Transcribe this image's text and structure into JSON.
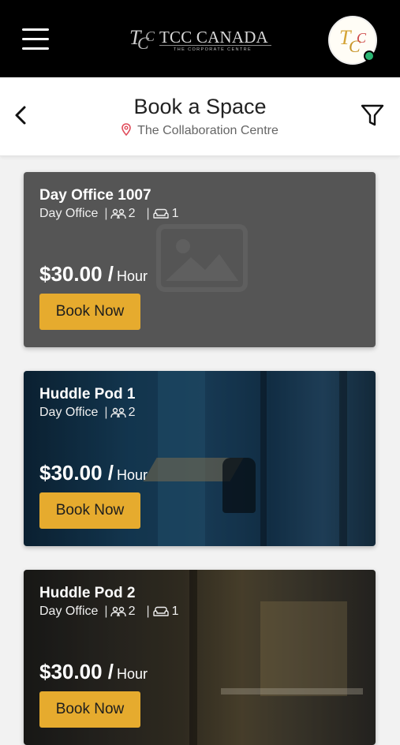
{
  "header": {
    "brand": "TCC CANADA",
    "brand_sub": "THE CORPORATE CENTRE",
    "avatar_alt": "TCC"
  },
  "page": {
    "title": "Book a Space",
    "location": "The Collaboration Centre"
  },
  "spaces": [
    {
      "name": "Day Office 1007",
      "type": "Day Office",
      "capacity": "2",
      "desks": "1",
      "price": "$30.00 /",
      "unit": "Hour",
      "cta": "Book Now"
    },
    {
      "name": "Huddle Pod 1",
      "type": "Day Office",
      "capacity": "2",
      "price": "$30.00 /",
      "unit": "Hour",
      "cta": "Book Now"
    },
    {
      "name": "Huddle Pod 2",
      "type": "Day Office",
      "capacity": "2",
      "desks": "1",
      "price": "$30.00 /",
      "unit": "Hour",
      "cta": "Book Now"
    }
  ],
  "colors": {
    "accent": "#e6ab2e",
    "header_bg": "#000000",
    "online": "#2bb673",
    "pin": "#e04b5a"
  },
  "icons": [
    "menu-icon",
    "back-icon",
    "location-pin-icon",
    "filter-icon",
    "people-icon",
    "sofa-icon",
    "image-placeholder-icon"
  ]
}
